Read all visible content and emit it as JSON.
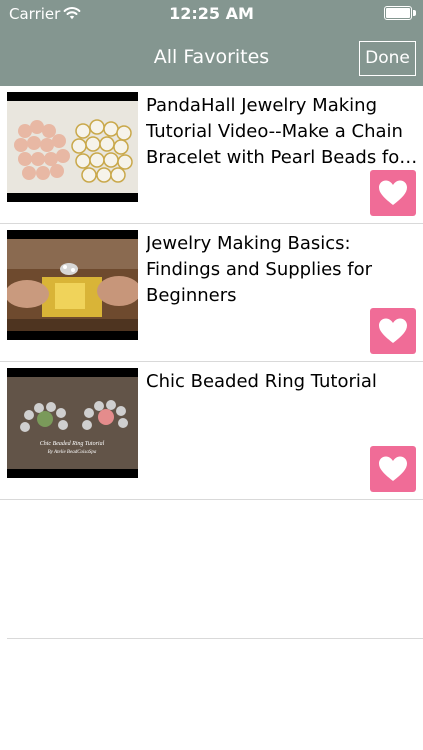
{
  "status_bar": {
    "carrier": "Carrier",
    "time": "12:25 AM",
    "battery_level": 1.0
  },
  "nav": {
    "title": "All Favorites",
    "done_label": "Done"
  },
  "favorites": [
    {
      "title": "PandaHall Jewelry Making Tutorial Video--Make a Chain Bracelet with Pearl Beads for B..."
    },
    {
      "title": "Jewelry Making Basics: Findings and Supplies for Beginners"
    },
    {
      "title": "Chic Beaded Ring Tutorial",
      "thumbnail_caption": "Chic Beaded Ring Tutorial By Atelie BeadCoisaSpa"
    }
  ],
  "colors": {
    "nav_bar": "#849690",
    "favorite_button": "#f06c97",
    "text": "#000000"
  },
  "icons": {
    "wifi": "wifi-icon",
    "battery": "battery-icon",
    "favorite": "heart-icon"
  }
}
